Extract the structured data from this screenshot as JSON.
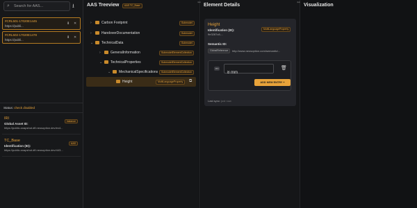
{
  "left": {
    "search_placeholder": "Search for AAS...",
    "aas_list": [
      {
        "id": "#CRL501-17020E1445",
        "url": "https://publi..."
      },
      {
        "id": "#CRL502-17020E1478",
        "url": "https://publi..."
      }
    ],
    "status_label": "Status:",
    "status_value": "check disabled",
    "submodel_cards": [
      {
        "name": "IRI",
        "label": "Global Asset ID:",
        "url": "https://public-snapshot.dfl.neosoption.dev/ex4...",
        "badge": "Instance"
      },
      {
        "name": "TC_Base",
        "label": "Identification (ID):",
        "url": "https://public-snapshot.dfl.neosoption.dev/443...",
        "badge": "AAS"
      }
    ]
  },
  "tree": {
    "title": "AAS Treeview",
    "title_tag": "AAS TC_Base",
    "nodes": [
      {
        "label": "Carbon Footprint",
        "tag": "Submodel"
      },
      {
        "label": "HandoverDocumentation",
        "tag": "Submodel"
      },
      {
        "label": "TechnicalData",
        "tag": "Submodel"
      },
      {
        "label": "GeneralInformation",
        "tag": "SubmodelElementCollection"
      },
      {
        "label": "TechnicalProperties",
        "tag": "SubmodelElementCollection"
      },
      {
        "label": "MechanicalSpecifications",
        "tag": "SubmodelElementCollection"
      },
      {
        "label": "Height",
        "tag": "MultiLanguageProperty"
      }
    ]
  },
  "details": {
    "title": "Element Details",
    "element_name": "Height",
    "element_tag": "MultiLanguageProperty",
    "id_label": "Identification (ID):",
    "id_value": "9e3287c8-...",
    "semantic_label": "Semantic ID:",
    "semantic_tag": "GlobalReference",
    "semantic_value": "http://www.neosoption.com/semantic/...",
    "lang": "en",
    "value": "8 mm",
    "add_button": "ADD NEW ENTRY",
    "last_sync_label": "Last sync:",
    "last_sync_value": "just now"
  },
  "viz": {
    "title": "Visualization"
  },
  "colors": {
    "accent": "#e8a33a",
    "background": "#111214",
    "card": "#24252a"
  }
}
